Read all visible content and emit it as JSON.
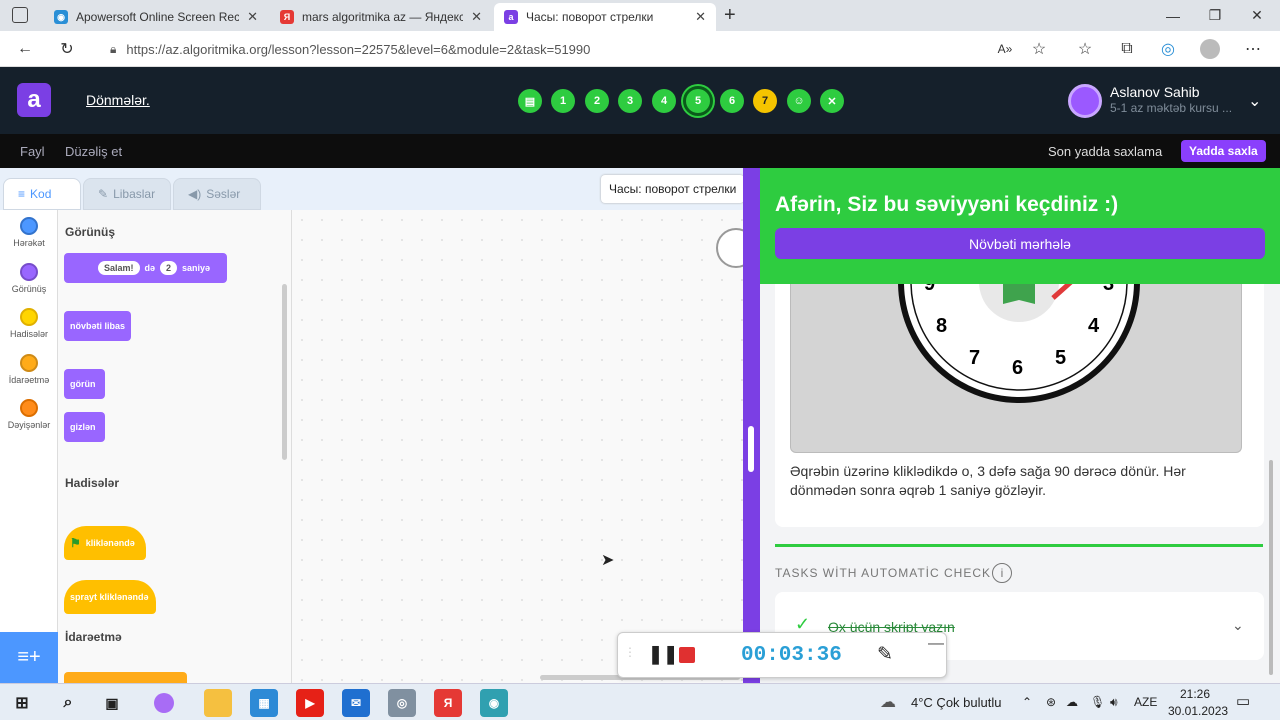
{
  "browser": {
    "tabs": [
      {
        "title": "Apowersoft Online Screen Recor",
        "icon": "apowersoft-icon"
      },
      {
        "title": "mars algoritmika az — Яндекс: н",
        "icon": "yandex-icon"
      },
      {
        "title": "Часы: поворот стрелки",
        "icon": "algoritmika-icon"
      }
    ],
    "url": "https://az.algoritmika.org/lesson?lesson=22575&level=6&module=2&task=51990"
  },
  "app": {
    "lesson_title": "Dönmələr.",
    "steps": [
      "1",
      "2",
      "3",
      "4",
      "5",
      "6",
      "7"
    ],
    "user_name": "Aslanov Sahib",
    "user_sub": "5-1 az məktəb kursu ..."
  },
  "menu": {
    "file": "Fayl",
    "edit": "Düzəliş et",
    "saved": "Son yadda saxlama",
    "save": "Yadda saxla"
  },
  "editor": {
    "tabs": [
      "Kod",
      "Libaslar",
      "Səslər"
    ],
    "categories": [
      {
        "label": "Hərəkət",
        "color": "#4c97ff"
      },
      {
        "label": "Görünüş",
        "color": "#9966ff"
      },
      {
        "label": "Hadisələr",
        "color": "#ffbf00"
      },
      {
        "label": "İdarəetmə",
        "color": "#ffab19"
      },
      {
        "label": "Dəyişənlər",
        "color": "#ff8c1a"
      }
    ],
    "sections": {
      "looks": "Görünüş",
      "events": "Hadisələr",
      "control": "İdarəetmə"
    },
    "blocks": {
      "say_text": "Salam!",
      "say_mid": "də",
      "say_num": "2",
      "say_end": "saniyə",
      "next_costume": "növbəti libas",
      "show": "görün",
      "hide": "gizlən",
      "flag_clicked": "kliklənəndə",
      "sprite_clicked": "sprayt kliklənəndə"
    },
    "sprite_name": "Часы: поворот стрелки"
  },
  "task": {
    "success": "Afərin, Siz bu səviyyəni keçdiniz :)",
    "next": "Növbəti mərhələ",
    "clock_numbers": [
      "9",
      "3",
      "8",
      "4",
      "7",
      "6",
      "5"
    ],
    "description": "Əqrəbin üzərinə kliklədikdə o, 3 dəfə sağa 90 dərəcə dönür. Hər dönmədən sonra əqrəb 1 saniyə gözləyir.",
    "auto_check_label": "TASKS WİTH AUTOMATİC CHECK",
    "check_item": "Ox üçün skript yazın"
  },
  "recorder": {
    "time": "00:03:36"
  },
  "taskbar": {
    "weather": "4°C  Çok bulutlu",
    "lang": "AZE",
    "time": "21:26",
    "date": "30.01.2023"
  }
}
